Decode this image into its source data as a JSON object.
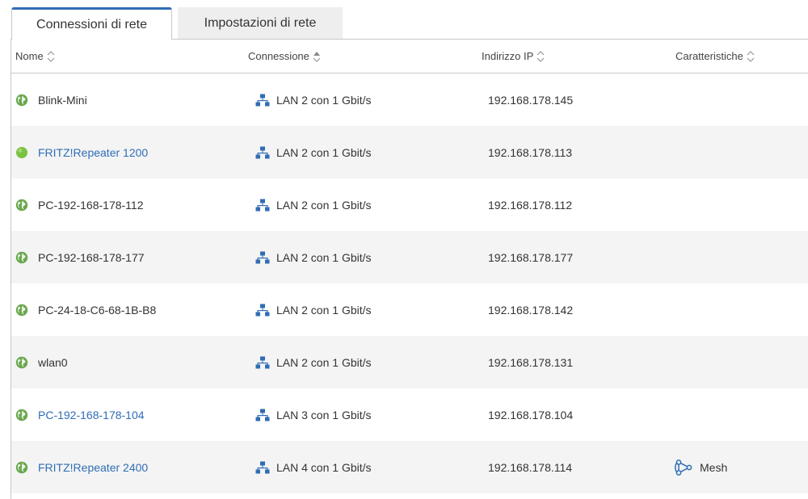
{
  "tabs": [
    {
      "label": "Connessioni di rete",
      "active": true
    },
    {
      "label": "Impostazioni di rete",
      "active": false
    }
  ],
  "table": {
    "headers": {
      "name": "Nome",
      "connection": "Connessione",
      "ip": "Indirizzo IP",
      "features": "Caratteristiche"
    },
    "rows": [
      {
        "name": "Blink-Mini",
        "link": false,
        "icon": "globe-icon",
        "connection": "LAN 2 con 1 Gbit/s",
        "ip": "192.168.178.145",
        "features": ""
      },
      {
        "name": "FRITZ!Repeater 1200",
        "link": true,
        "icon": "status-dot-icon",
        "connection": "LAN 2 con 1 Gbit/s",
        "ip": "192.168.178.113",
        "features": ""
      },
      {
        "name": "PC-192-168-178-112",
        "link": false,
        "icon": "globe-icon",
        "connection": "LAN 2 con 1 Gbit/s",
        "ip": "192.168.178.112",
        "features": ""
      },
      {
        "name": "PC-192-168-178-177",
        "link": false,
        "icon": "globe-icon",
        "connection": "LAN 2 con 1 Gbit/s",
        "ip": "192.168.178.177",
        "features": ""
      },
      {
        "name": "PC-24-18-C6-68-1B-B8",
        "link": false,
        "icon": "globe-icon",
        "connection": "LAN 2 con 1 Gbit/s",
        "ip": "192.168.178.142",
        "features": ""
      },
      {
        "name": "wlan0",
        "link": false,
        "icon": "globe-icon",
        "connection": "LAN 2 con 1 Gbit/s",
        "ip": "192.168.178.131",
        "features": ""
      },
      {
        "name": "PC-192-168-178-104",
        "link": true,
        "icon": "globe-icon",
        "connection": "LAN 3 con 1 Gbit/s",
        "ip": "192.168.178.104",
        "features": ""
      },
      {
        "name": "FRITZ!Repeater 2400",
        "link": true,
        "icon": "globe-icon",
        "connection": "LAN 4 con 1 Gbit/s",
        "ip": "192.168.178.114",
        "features": "Mesh"
      }
    ]
  },
  "colors": {
    "accent": "#2f6db5",
    "globe_green": "#6aa84f",
    "status_green": "#7cc242",
    "lan_blue": "#2f6db5"
  }
}
